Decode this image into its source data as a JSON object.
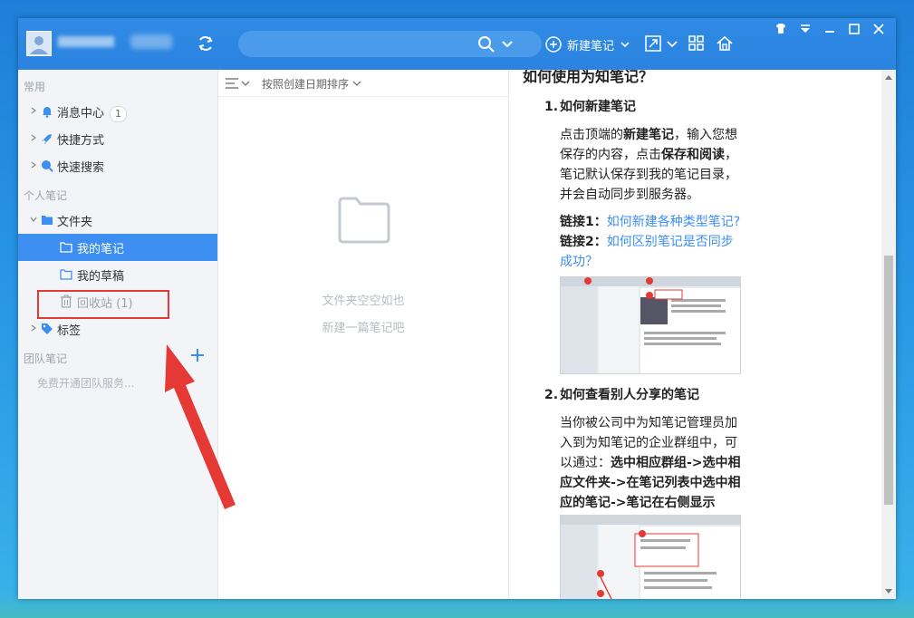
{
  "titlebar": {
    "search_placeholder": "",
    "new_note_label": "新建笔记"
  },
  "sidebar": {
    "section_common": "常用",
    "items_common": [
      {
        "label": "消息中心",
        "badge": "1"
      },
      {
        "label": "快捷方式"
      },
      {
        "label": "快速搜索"
      }
    ],
    "section_personal": "个人笔记",
    "folder_root": "文件夹",
    "folders": [
      {
        "label": "我的笔记"
      },
      {
        "label": "我的草稿"
      }
    ],
    "trash_label": "回收站",
    "trash_count": "(1)",
    "tags_label": "标签",
    "section_team": "团队笔记",
    "team_tip": "免费开通团队服务..."
  },
  "list": {
    "sort_label": "按照创建日期排序",
    "empty_line1": "文件夹空空如也",
    "empty_line2": "新建一篇笔记吧"
  },
  "content": {
    "heading": "如何使用为知笔记？",
    "s1_num": "1.",
    "s1_title": "如何新建笔记",
    "s1_p1_a": "点击顶端的",
    "s1_p1_b": "新建笔记",
    "s1_p1_c": "，输入您想",
    "s1_p2_a": "保存的内容，点击",
    "s1_p2_b": "保存和阅读",
    "s1_p2_c": "，",
    "s1_p3": "笔记默认保存到我的笔记目录，",
    "s1_p4": "并会自动同步到服务器。",
    "link1_label": "链接1",
    "link1_text": "如何新建各种类型笔记?",
    "link2_label": "链接2",
    "link2_text_a": "如何区别笔记是否同步",
    "link2_text_b": "成功？",
    "colon": "：",
    "s2_num": "2.",
    "s2_title": "如何查看别人分享的笔记",
    "s2_p1": "当你被公司中为知笔记管理员加",
    "s2_p2": "入到为知笔记的企业群组中，可",
    "s2_p3_a": "以通过：",
    "s2_p3_b": "选中相应群组->选中相",
    "s2_p4": "应文件夹->在笔记列表中选中相",
    "s2_p5": "应的笔记->笔记在右侧显示"
  },
  "colors": {
    "titlebar": "#2a83df",
    "accent": "#3c8ef0",
    "annotation_red": "#e53935"
  }
}
